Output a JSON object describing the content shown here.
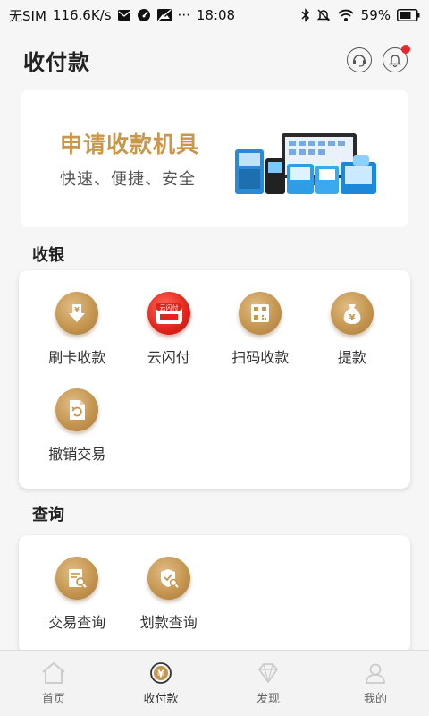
{
  "status_bar": {
    "sim": "无SIM",
    "speed": "116.6K/s",
    "dots": "···",
    "time": "18:08",
    "battery": "59%"
  },
  "header": {
    "title": "收付款",
    "notification_dot_color": "#e8262b"
  },
  "banner": {
    "title": "申请收款机具",
    "subtitle": "快速、便捷、安全",
    "title_color": "#c9974b"
  },
  "sections": {
    "cashier": {
      "title": "收银",
      "items": [
        {
          "label": "刷卡收款",
          "icon": "card-swipe-icon"
        },
        {
          "label": "云闪付",
          "icon": "quickpass-icon"
        },
        {
          "label": "扫码收款",
          "icon": "qr-scan-icon"
        },
        {
          "label": "提款",
          "icon": "money-bag-icon"
        },
        {
          "label": "撤销交易",
          "icon": "revoke-document-icon"
        }
      ]
    },
    "query": {
      "title": "查询",
      "items": [
        {
          "label": "交易查询",
          "icon": "transaction-search-icon"
        },
        {
          "label": "划款查询",
          "icon": "transfer-search-icon"
        }
      ]
    }
  },
  "bottom_nav": {
    "items": [
      {
        "label": "首页",
        "icon": "home-icon"
      },
      {
        "label": "收付款",
        "icon": "yuan-icon",
        "active": true
      },
      {
        "label": "发现",
        "icon": "discover-icon"
      },
      {
        "label": "我的",
        "icon": "profile-icon"
      }
    ]
  },
  "colors": {
    "accent_gold": "#c59650",
    "background": "#f6f6f6"
  },
  "quickpass_badge": "云闪付"
}
